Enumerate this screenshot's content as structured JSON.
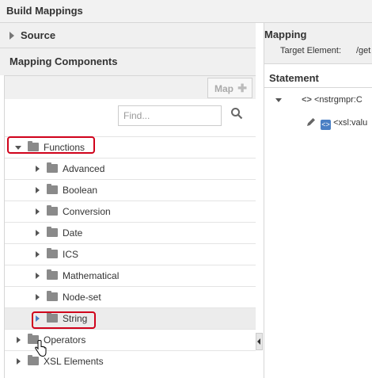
{
  "window": {
    "title": "Build Mappings"
  },
  "left": {
    "source_label": "Source",
    "components_label": "Mapping Components",
    "map_button": "Map",
    "find_placeholder": "Find...",
    "tree": {
      "functions": "Functions",
      "children": [
        "Advanced",
        "Boolean",
        "Conversion",
        "Date",
        "ICS",
        "Mathematical",
        "Node-set",
        "String"
      ],
      "operators": "Operators",
      "xsl_elements": "XSL Elements"
    }
  },
  "right": {
    "mapping_title": "Mapping",
    "target_label": "Target Element:",
    "target_value": "/get",
    "statement_label": "Statement",
    "node1": "<nstrgmpr:C",
    "node2": "<xsl:valu"
  },
  "colors": {
    "highlight": "#d0021b"
  }
}
